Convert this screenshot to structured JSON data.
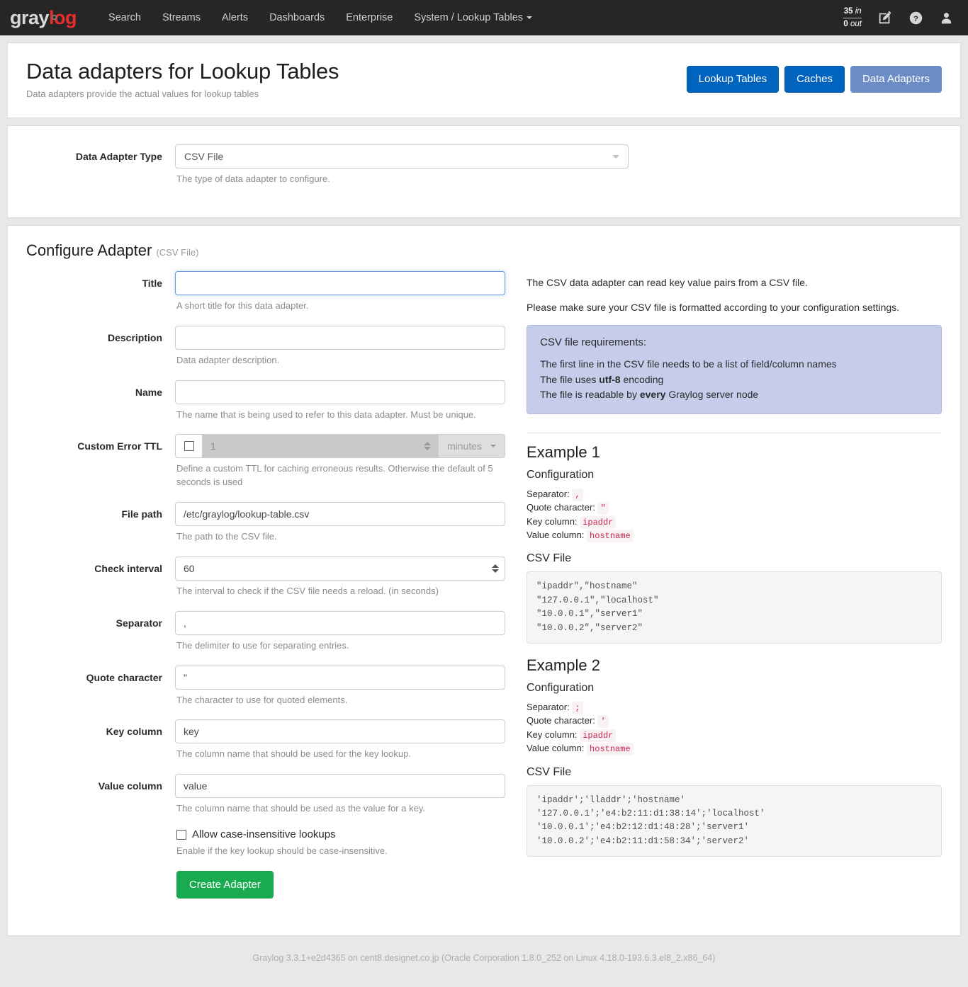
{
  "navbar": {
    "brand": {
      "part1": "gray",
      "part2": "log"
    },
    "links": [
      {
        "label": "Search",
        "name": "nav-search"
      },
      {
        "label": "Streams",
        "name": "nav-streams"
      },
      {
        "label": "Alerts",
        "name": "nav-alerts"
      },
      {
        "label": "Dashboards",
        "name": "nav-dashboards"
      },
      {
        "label": "Enterprise",
        "name": "nav-enterprise"
      },
      {
        "label": "System / Lookup Tables",
        "name": "nav-system-lookup-tables",
        "has_caret": true
      }
    ],
    "throughput": {
      "in_value": "35",
      "in_unit": "in",
      "out_value": "0",
      "out_unit": "out"
    },
    "icons": [
      {
        "name": "edit-icon"
      },
      {
        "name": "help-icon"
      },
      {
        "name": "user-icon"
      }
    ]
  },
  "header": {
    "title": "Data adapters for Lookup Tables",
    "subtitle": "Data adapters provide the actual values for lookup tables",
    "actions": [
      {
        "label": "Lookup Tables",
        "name": "lookup-tables-button",
        "style": "primary"
      },
      {
        "label": "Caches",
        "name": "caches-button",
        "style": "primary"
      },
      {
        "label": "Data Adapters",
        "name": "data-adapters-button",
        "style": "active"
      }
    ]
  },
  "adapter_type": {
    "label": "Data Adapter Type",
    "selected": "CSV File",
    "help": "The type of data adapter to configure."
  },
  "configure": {
    "title": "Configure Adapter",
    "subtitle": "(CSV File)",
    "fields": {
      "title": {
        "label": "Title",
        "value": "",
        "help": "A short title for this data adapter."
      },
      "description": {
        "label": "Description",
        "value": "",
        "help": "Data adapter description."
      },
      "name": {
        "label": "Name",
        "value": "",
        "help": "The name that is being used to refer to this data adapter. Must be unique."
      },
      "custom_error_ttl": {
        "label": "Custom Error TTL",
        "value": "1",
        "unit": "minutes",
        "enabled": false,
        "help": "Define a custom TTL for caching erroneous results. Otherwise the default of 5 seconds is used"
      },
      "file_path": {
        "label": "File path",
        "value": "/etc/graylog/lookup-table.csv",
        "help": "The path to the CSV file."
      },
      "check_interval": {
        "label": "Check interval",
        "value": "60",
        "help": "The interval to check if the CSV file needs a reload. (in seconds)"
      },
      "separator": {
        "label": "Separator",
        "value": ",",
        "help": "The delimiter to use for separating entries."
      },
      "quote_character": {
        "label": "Quote character",
        "value": "\"",
        "help": "The character to use for quoted elements."
      },
      "key_column": {
        "label": "Key column",
        "value": "key",
        "help": "The column name that should be used for the key lookup."
      },
      "value_column": {
        "label": "Value column",
        "value": "value",
        "help": "The column name that should be used as the value for a key."
      },
      "case_insensitive": {
        "label": "Allow case-insensitive lookups",
        "checked": false,
        "help": "Enable if the key lookup should be case-insensitive."
      }
    },
    "submit_label": "Create Adapter"
  },
  "documentation": {
    "intro1": "The CSV data adapter can read key value pairs from a CSV file.",
    "intro2": "Please make sure your CSV file is formatted according to your configuration settings.",
    "requirements": {
      "heading": "CSV file requirements:",
      "line1": "The first line in the CSV file needs to be a list of field/column names",
      "line2_pre": "The file uses ",
      "line2_strong": "utf-8",
      "line2_post": " encoding",
      "line3_pre": "The file is readable by ",
      "line3_strong": "every",
      "line3_post": " Graylog server node"
    },
    "examples": [
      {
        "title": "Example 1",
        "config_heading": "Configuration",
        "separator_label": "Separator:",
        "separator_value": ",",
        "quote_label": "Quote character:",
        "quote_value": "\"",
        "key_label": "Key column:",
        "key_value": "ipaddr",
        "value_label": "Value column:",
        "value_value": "hostname",
        "csv_heading": "CSV File",
        "csv_content": "\"ipaddr\",\"hostname\"\n\"127.0.0.1\",\"localhost\"\n\"10.0.0.1\",\"server1\"\n\"10.0.0.2\",\"server2\""
      },
      {
        "title": "Example 2",
        "config_heading": "Configuration",
        "separator_label": "Separator:",
        "separator_value": ";",
        "quote_label": "Quote character:",
        "quote_value": "'",
        "key_label": "Key column:",
        "key_value": "ipaddr",
        "value_label": "Value column:",
        "value_value": "hostname",
        "csv_heading": "CSV File",
        "csv_content": "'ipaddr';'lladdr';'hostname'\n'127.0.0.1';'e4:b2:11:d1:38:14';'localhost'\n'10.0.0.1';'e4:b2:12:d1:48:28';'server1'\n'10.0.0.2';'e4:b2:11:d1:58:34';'server2'"
      }
    ]
  },
  "footer": {
    "text": "Graylog 3.3.1+e2d4365 on cent8.designet.co.jp (Oracle Corporation 1.8.0_252 on Linux 4.18.0-193.6.3.el8_2.x86_64)"
  },
  "colors": {
    "navbar_bg": "#262626",
    "brand_red": "#ea2c2c",
    "primary": "#0063be",
    "active": "#6b8cc4",
    "success": "#1aab50",
    "info_bg": "#c5cdeb",
    "code_pink": "#c7254e"
  }
}
